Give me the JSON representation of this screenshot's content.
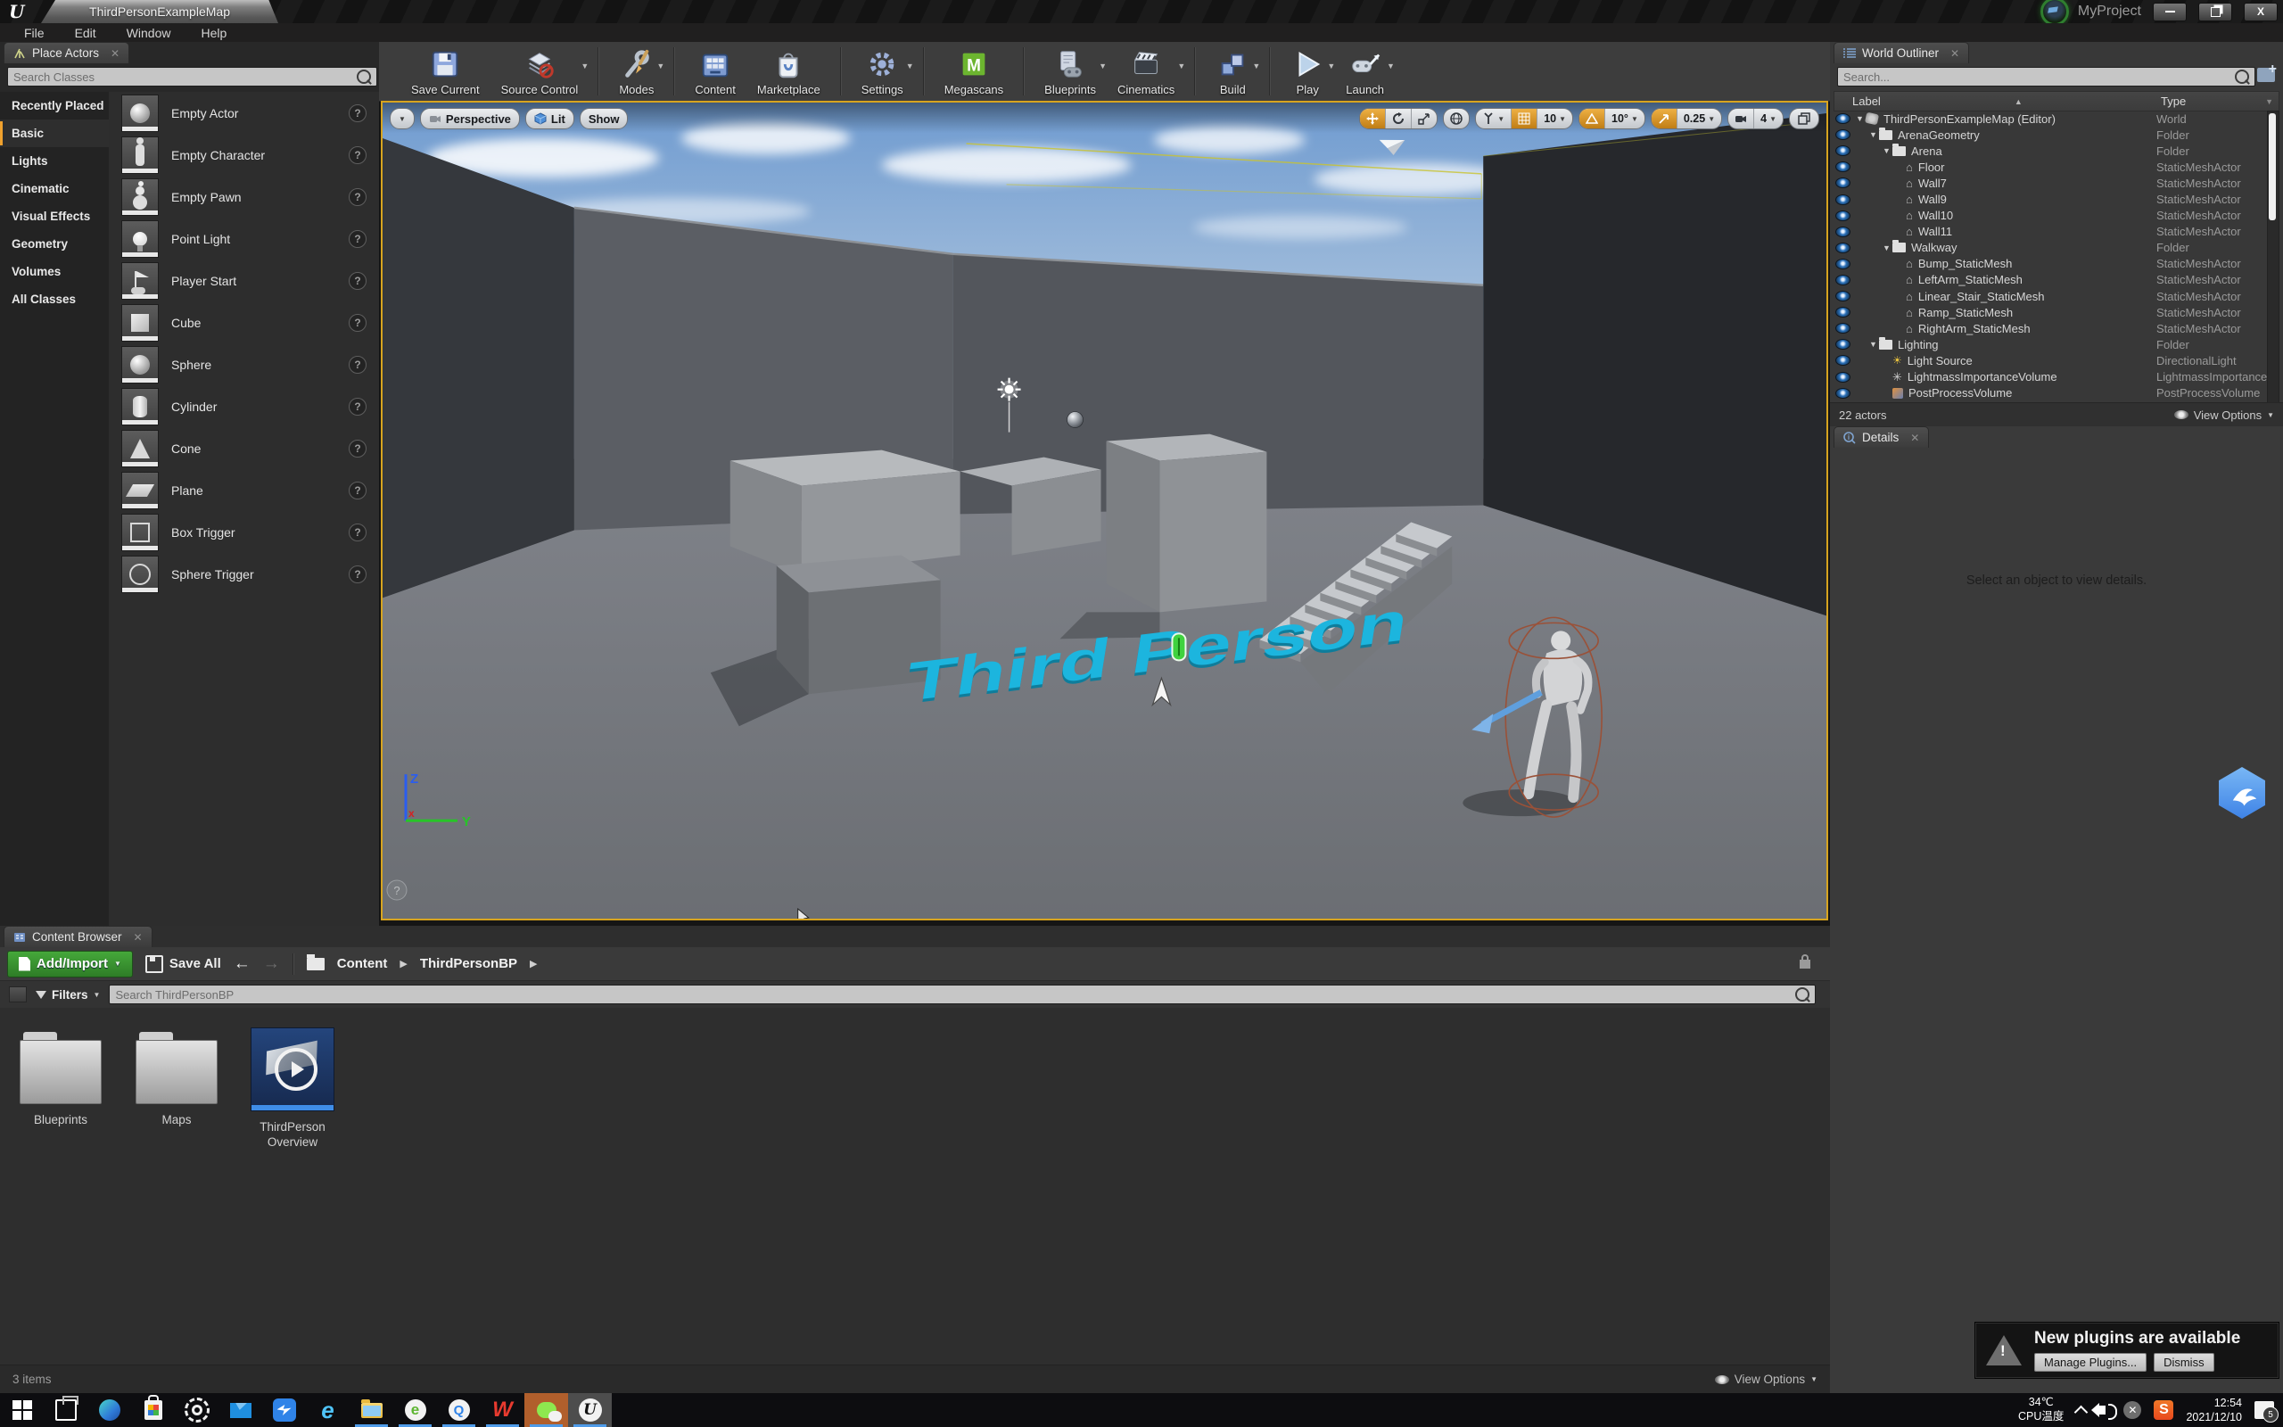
{
  "colors": {
    "accent_orange": "#efa12e",
    "viewport_active_border": "#d7a41f",
    "megascans_green": "#6cb52f",
    "add_import_green": "#3a9a30",
    "scene_text_cyan": "#1cb5de",
    "taskbar_running_blue": "#4f9be8",
    "wechat_highlight": "#b15f2c"
  },
  "window": {
    "tab_title": "ThirdPersonExampleMap",
    "project_name": "MyProject",
    "menus": [
      "File",
      "Edit",
      "Window",
      "Help"
    ]
  },
  "toolbar": {
    "items": [
      {
        "label": "Save Current",
        "icon": "save"
      },
      {
        "label": "Source Control",
        "icon": "source",
        "caret": true
      },
      {
        "sep": true
      },
      {
        "label": "Modes",
        "icon": "modes",
        "caret": true
      },
      {
        "sep": true
      },
      {
        "label": "Content",
        "icon": "content"
      },
      {
        "label": "Marketplace",
        "icon": "market"
      },
      {
        "sep": true
      },
      {
        "label": "Settings",
        "icon": "settings",
        "caret": true
      },
      {
        "sep": true
      },
      {
        "label": "Megascans",
        "icon": "megascans"
      },
      {
        "sep": true
      },
      {
        "label": "Blueprints",
        "icon": "blueprints",
        "caret": true
      },
      {
        "label": "Cinematics",
        "icon": "cinematics",
        "caret": true
      },
      {
        "sep": true
      },
      {
        "label": "Build",
        "icon": "build",
        "caret": true
      },
      {
        "sep": true
      },
      {
        "label": "Play",
        "icon": "play",
        "caret": true
      },
      {
        "label": "Launch",
        "icon": "launch",
        "caret": true
      }
    ]
  },
  "place_actors": {
    "tab": "Place Actors",
    "search_placeholder": "Search Classes",
    "selected_category": "Basic",
    "categories": [
      "Recently Placed",
      "Basic",
      "Lights",
      "Cinematic",
      "Visual Effects",
      "Geometry",
      "Volumes",
      "All Classes"
    ],
    "items": [
      {
        "label": "Empty Actor",
        "thumb": "sphere"
      },
      {
        "label": "Empty Character",
        "thumb": "char"
      },
      {
        "label": "Empty Pawn",
        "thumb": "pawn"
      },
      {
        "label": "Point Light",
        "thumb": "bulb"
      },
      {
        "label": "Player Start",
        "thumb": "flag"
      },
      {
        "label": "Cube",
        "thumb": "cube"
      },
      {
        "label": "Sphere",
        "thumb": "sphere"
      },
      {
        "label": "Cylinder",
        "thumb": "cyl"
      },
      {
        "label": "Cone",
        "thumb": "cone"
      },
      {
        "label": "Plane",
        "thumb": "plane"
      },
      {
        "label": "Box Trigger",
        "thumb": "boxtr"
      },
      {
        "label": "Sphere Trigger",
        "thumb": "sphtr"
      }
    ]
  },
  "viewport": {
    "camera_mode": "Perspective",
    "view_mode": "Lit",
    "show_label": "Show",
    "grid_snap": "10",
    "rotation_snap": "10°",
    "scale_snap": "0.25",
    "camera_speed": "4",
    "scene_text": "Third Person",
    "axis": {
      "z": "Z",
      "y": "Y",
      "x": "x"
    },
    "help_glyph": "?"
  },
  "world_outliner": {
    "tab": "World Outliner",
    "search_placeholder": "Search...",
    "columns": {
      "label": "Label",
      "type": "Type"
    },
    "rows": [
      {
        "label": "ThirdPersonExampleMap (Editor)",
        "type": "World",
        "depth": 0,
        "icon": "world",
        "expander": true
      },
      {
        "label": "ArenaGeometry",
        "type": "Folder",
        "depth": 1,
        "icon": "folder",
        "expander": true
      },
      {
        "label": "Arena",
        "type": "Folder",
        "depth": 2,
        "icon": "folder",
        "expander": true
      },
      {
        "label": "Floor",
        "type": "StaticMeshActor",
        "depth": 3,
        "icon": "mesh"
      },
      {
        "label": "Wall7",
        "type": "StaticMeshActor",
        "depth": 3,
        "icon": "mesh"
      },
      {
        "label": "Wall9",
        "type": "StaticMeshActor",
        "depth": 3,
        "icon": "mesh"
      },
      {
        "label": "Wall10",
        "type": "StaticMeshActor",
        "depth": 3,
        "icon": "mesh"
      },
      {
        "label": "Wall11",
        "type": "StaticMeshActor",
        "depth": 3,
        "icon": "mesh"
      },
      {
        "label": "Walkway",
        "type": "Folder",
        "depth": 2,
        "icon": "folder",
        "expander": true
      },
      {
        "label": "Bump_StaticMesh",
        "type": "StaticMeshActor",
        "depth": 3,
        "icon": "mesh"
      },
      {
        "label": "LeftArm_StaticMesh",
        "type": "StaticMeshActor",
        "depth": 3,
        "icon": "mesh"
      },
      {
        "label": "Linear_Stair_StaticMesh",
        "type": "StaticMeshActor",
        "depth": 3,
        "icon": "mesh"
      },
      {
        "label": "Ramp_StaticMesh",
        "type": "StaticMeshActor",
        "depth": 3,
        "icon": "mesh"
      },
      {
        "label": "RightArm_StaticMesh",
        "type": "StaticMeshActor",
        "depth": 3,
        "icon": "mesh"
      },
      {
        "label": "Lighting",
        "type": "Folder",
        "depth": 1,
        "icon": "folder",
        "expander": true
      },
      {
        "label": "Light Source",
        "type": "DirectionalLight",
        "depth": 2,
        "icon": "light"
      },
      {
        "label": "LightmassImportanceVolume",
        "type": "LightmassImportanceVo",
        "depth": 2,
        "icon": "lmass"
      },
      {
        "label": "PostProcessVolume",
        "type": "PostProcessVolume",
        "depth": 2,
        "icon": "ppv"
      }
    ],
    "status": "22 actors",
    "view_options": "View Options"
  },
  "details": {
    "tab": "Details",
    "empty_text": "Select an object to view details."
  },
  "content_browser": {
    "tab": "Content Browser",
    "add_import": "Add/Import",
    "save_all": "Save All",
    "breadcrumb_root": "Content",
    "breadcrumb_current": "ThirdPersonBP",
    "filters": "Filters",
    "search_placeholder": "Search ThirdPersonBP",
    "assets": [
      {
        "label": "Blueprints",
        "kind": "folder"
      },
      {
        "label": "Maps",
        "kind": "folder"
      },
      {
        "label": "ThirdPerson Overview",
        "kind": "overview"
      }
    ],
    "status": "3 items",
    "view_options": "View Options"
  },
  "notification": {
    "title": "New plugins are available",
    "manage_button": "Manage Plugins...",
    "dismiss_button": "Dismiss"
  },
  "taskbar": {
    "apps": [
      {
        "name": "start"
      },
      {
        "name": "task-view"
      },
      {
        "name": "edge"
      },
      {
        "name": "store"
      },
      {
        "name": "settings"
      },
      {
        "name": "mail"
      },
      {
        "name": "thunder"
      },
      {
        "name": "internet-explorer"
      },
      {
        "name": "file-explorer",
        "running": true
      },
      {
        "name": "browser-360",
        "running": true
      },
      {
        "name": "qq-browser",
        "running": true
      },
      {
        "name": "wps",
        "running": true
      },
      {
        "name": "wechat",
        "running": true,
        "highlight": "wechat"
      },
      {
        "name": "unreal-engine",
        "running": true,
        "highlight": "ue"
      }
    ],
    "tray": {
      "temperature": "34℃",
      "temperature_label": "CPU温度",
      "sogou_glyph": "S",
      "time": "12:54",
      "date": "2021/12/10",
      "badge_count": "5"
    }
  }
}
